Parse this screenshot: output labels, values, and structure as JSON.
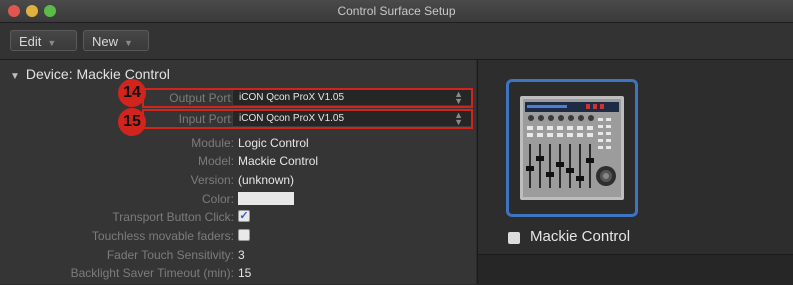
{
  "window": {
    "title": "Control Surface Setup"
  },
  "toolbar": {
    "edit_label": "Edit",
    "new_label": "New",
    "arrow": "▼"
  },
  "device": {
    "header_label": "Device: Mackie Control",
    "header_arrow": "▼"
  },
  "fields": {
    "output_port": {
      "label": "Output Port:",
      "value": "iCON Qcon ProX V1.05",
      "callout": "14"
    },
    "input_port": {
      "label": "Input Port:",
      "value": "iCON Qcon ProX V1.05",
      "callout": "15"
    },
    "module": {
      "label": "Module:",
      "value": "Logic Control"
    },
    "model": {
      "label": "Model:",
      "value": "Mackie Control"
    },
    "version": {
      "label": "Version:",
      "value": "(unknown)"
    },
    "color": {
      "label": "Color:",
      "swatch": "#e8e8e8"
    },
    "transport_click": {
      "label": "Transport Button Click:",
      "checked": true
    },
    "touchless_faders": {
      "label": "Touchless movable faders:",
      "checked": false
    },
    "fader_touch": {
      "label": "Fader Touch Sensitivity:",
      "value": "3"
    },
    "backlight": {
      "label": "Backlight Saver Timeout (min):",
      "value": "15"
    }
  },
  "device_tile": {
    "label": "Mackie Control",
    "icon": "mackie-control-device-icon"
  },
  "colors": {
    "callout": "#d0241d",
    "selection": "#3e74c2",
    "check": "#2f5fcf"
  }
}
